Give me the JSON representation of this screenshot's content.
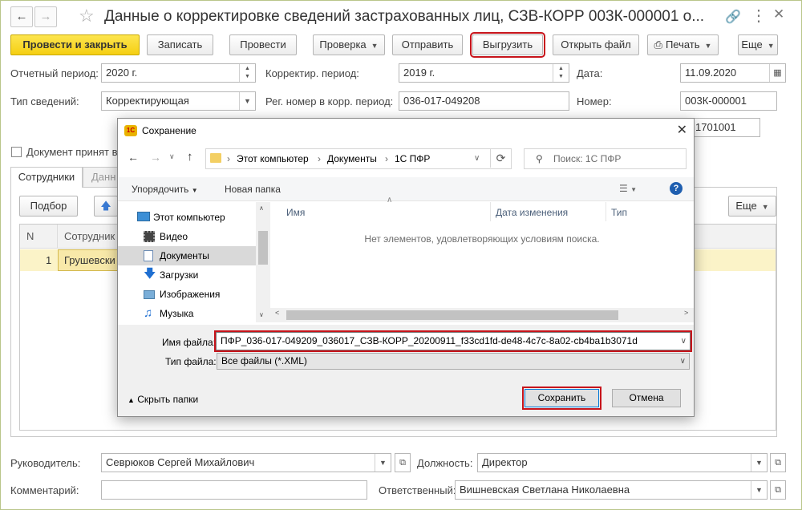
{
  "window": {
    "title": "Данные о корректировке сведений застрахованных лиц, СЗВ-КОРР 003К-000001 о..."
  },
  "toolbar": {
    "post_close": "Провести и закрыть",
    "save": "Записать",
    "post": "Провести",
    "check": "Проверка",
    "send": "Отправить",
    "export": "Выгрузить",
    "open_file": "Открыть файл",
    "print": "Печать",
    "more": "Еще"
  },
  "form": {
    "period_label": "Отчетный период:",
    "period_value": "2020 г.",
    "corr_period_label": "Корректир. период:",
    "corr_period_value": "2019 г.",
    "date_label": "Дата:",
    "date_value": "11.09.2020",
    "type_label": "Тип сведений:",
    "type_value": "Корректирующая",
    "reg_label": "Рег. номер в корр. период:",
    "reg_value": "036-017-049208",
    "number_label": "Номер:",
    "number_value": "003К-000001",
    "partial_value": "1701001",
    "accepted_label": "Документ принят в"
  },
  "tabs": {
    "employees": "Сотрудники",
    "data_partial": "Данн"
  },
  "table": {
    "pick_button": "Подбор",
    "more": "Еще",
    "col_n": "N",
    "col_employee": "Сотрудник",
    "rows": [
      {
        "n": "1",
        "employee": "Грушевски"
      }
    ]
  },
  "footer": {
    "head_label": "Руководитель:",
    "head_value": "Севрюков Сергей Михайлович",
    "position_label": "Должность:",
    "position_value": "Директор",
    "comment_label": "Комментарий:",
    "responsible_label": "Ответственный:",
    "responsible_value": "Вишневская Светлана Николаевна"
  },
  "dialog": {
    "title": "Сохранение",
    "path": {
      "segments": [
        "Этот компьютер",
        "Документы",
        "1С ПФР"
      ]
    },
    "search_placeholder": "Поиск: 1С ПФР",
    "organize": "Упорядочить",
    "new_folder": "Новая папка",
    "tree": [
      {
        "label": "Этот компьютер",
        "icon": "computer-icon"
      },
      {
        "label": "Видео",
        "icon": "video-icon"
      },
      {
        "label": "Документы",
        "icon": "documents-icon"
      },
      {
        "label": "Загрузки",
        "icon": "downloads-icon"
      },
      {
        "label": "Изображения",
        "icon": "images-icon"
      },
      {
        "label": "Музыка",
        "icon": "music-icon"
      }
    ],
    "columns": {
      "name": "Имя",
      "date": "Дата изменения",
      "type": "Тип"
    },
    "empty_text": "Нет элементов, удовлетворяющих условиям поиска.",
    "filename_label": "Имя файла:",
    "filename_value": "ПФР_036-017-049209_036017_СЗВ-КОРР_20200911_f33cd1fd-de48-4c7c-8a02-cb4ba1b3071d",
    "filetype_label": "Тип файла:",
    "filetype_value": "Все файлы (*.XML)",
    "hide_folders": "Скрыть папки",
    "save_button": "Сохранить",
    "cancel_button": "Отмена"
  },
  "colors": {
    "accent_yellow": "#f5cf12",
    "highlight_red": "#c7141b",
    "row_highlight": "#fbf3c8"
  }
}
